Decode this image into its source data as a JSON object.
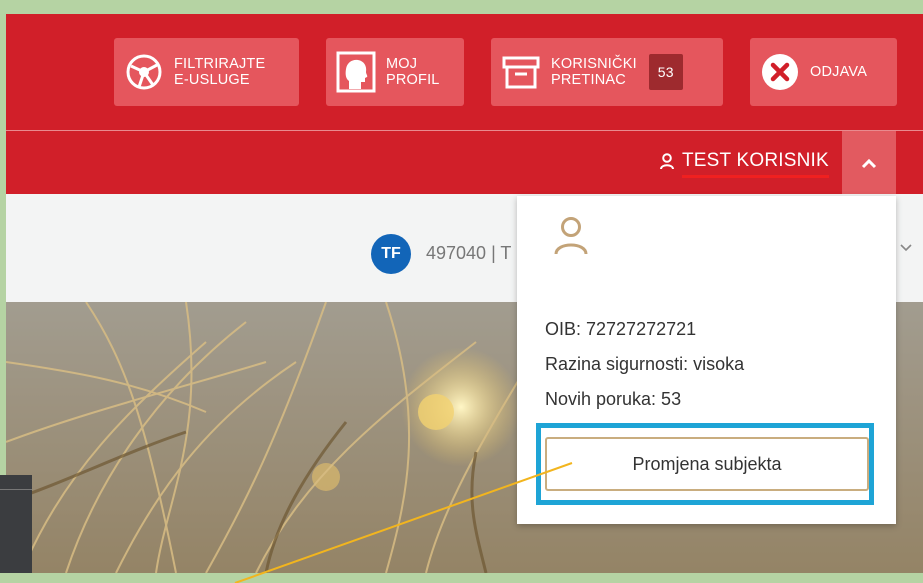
{
  "header": {
    "buttons": [
      {
        "line1": "FILTRIRAJTE",
        "line2": "E-USLUGE",
        "icon": "filter-services-icon"
      },
      {
        "line1": "MOJ",
        "line2": "PROFIL",
        "icon": "profile-icon"
      },
      {
        "line1": "KORISNIČKI",
        "line2": "PRETINAC",
        "icon": "inbox-icon",
        "badge": "53"
      },
      {
        "line1": "ODJAVA",
        "line2": "",
        "icon": "close-icon"
      }
    ],
    "user_name": "TEST KORISNIK"
  },
  "subject": {
    "initials": "TF",
    "text": "497040 | T"
  },
  "dropdown": {
    "oib": "OIB: 72727272721",
    "security_level": "Razina sigurnosti: visoka",
    "new_messages": "Novih poruka: 53",
    "change_subject_label": "Promjena subjekta"
  },
  "colors": {
    "header_red": "#d11f29",
    "button_bg": "#e5565d",
    "highlight_blue": "#1ea4d6",
    "button_border_gold": "#c9ad7f",
    "callout_line": "#f2b51e",
    "outer_green": "#b5d3a3"
  }
}
